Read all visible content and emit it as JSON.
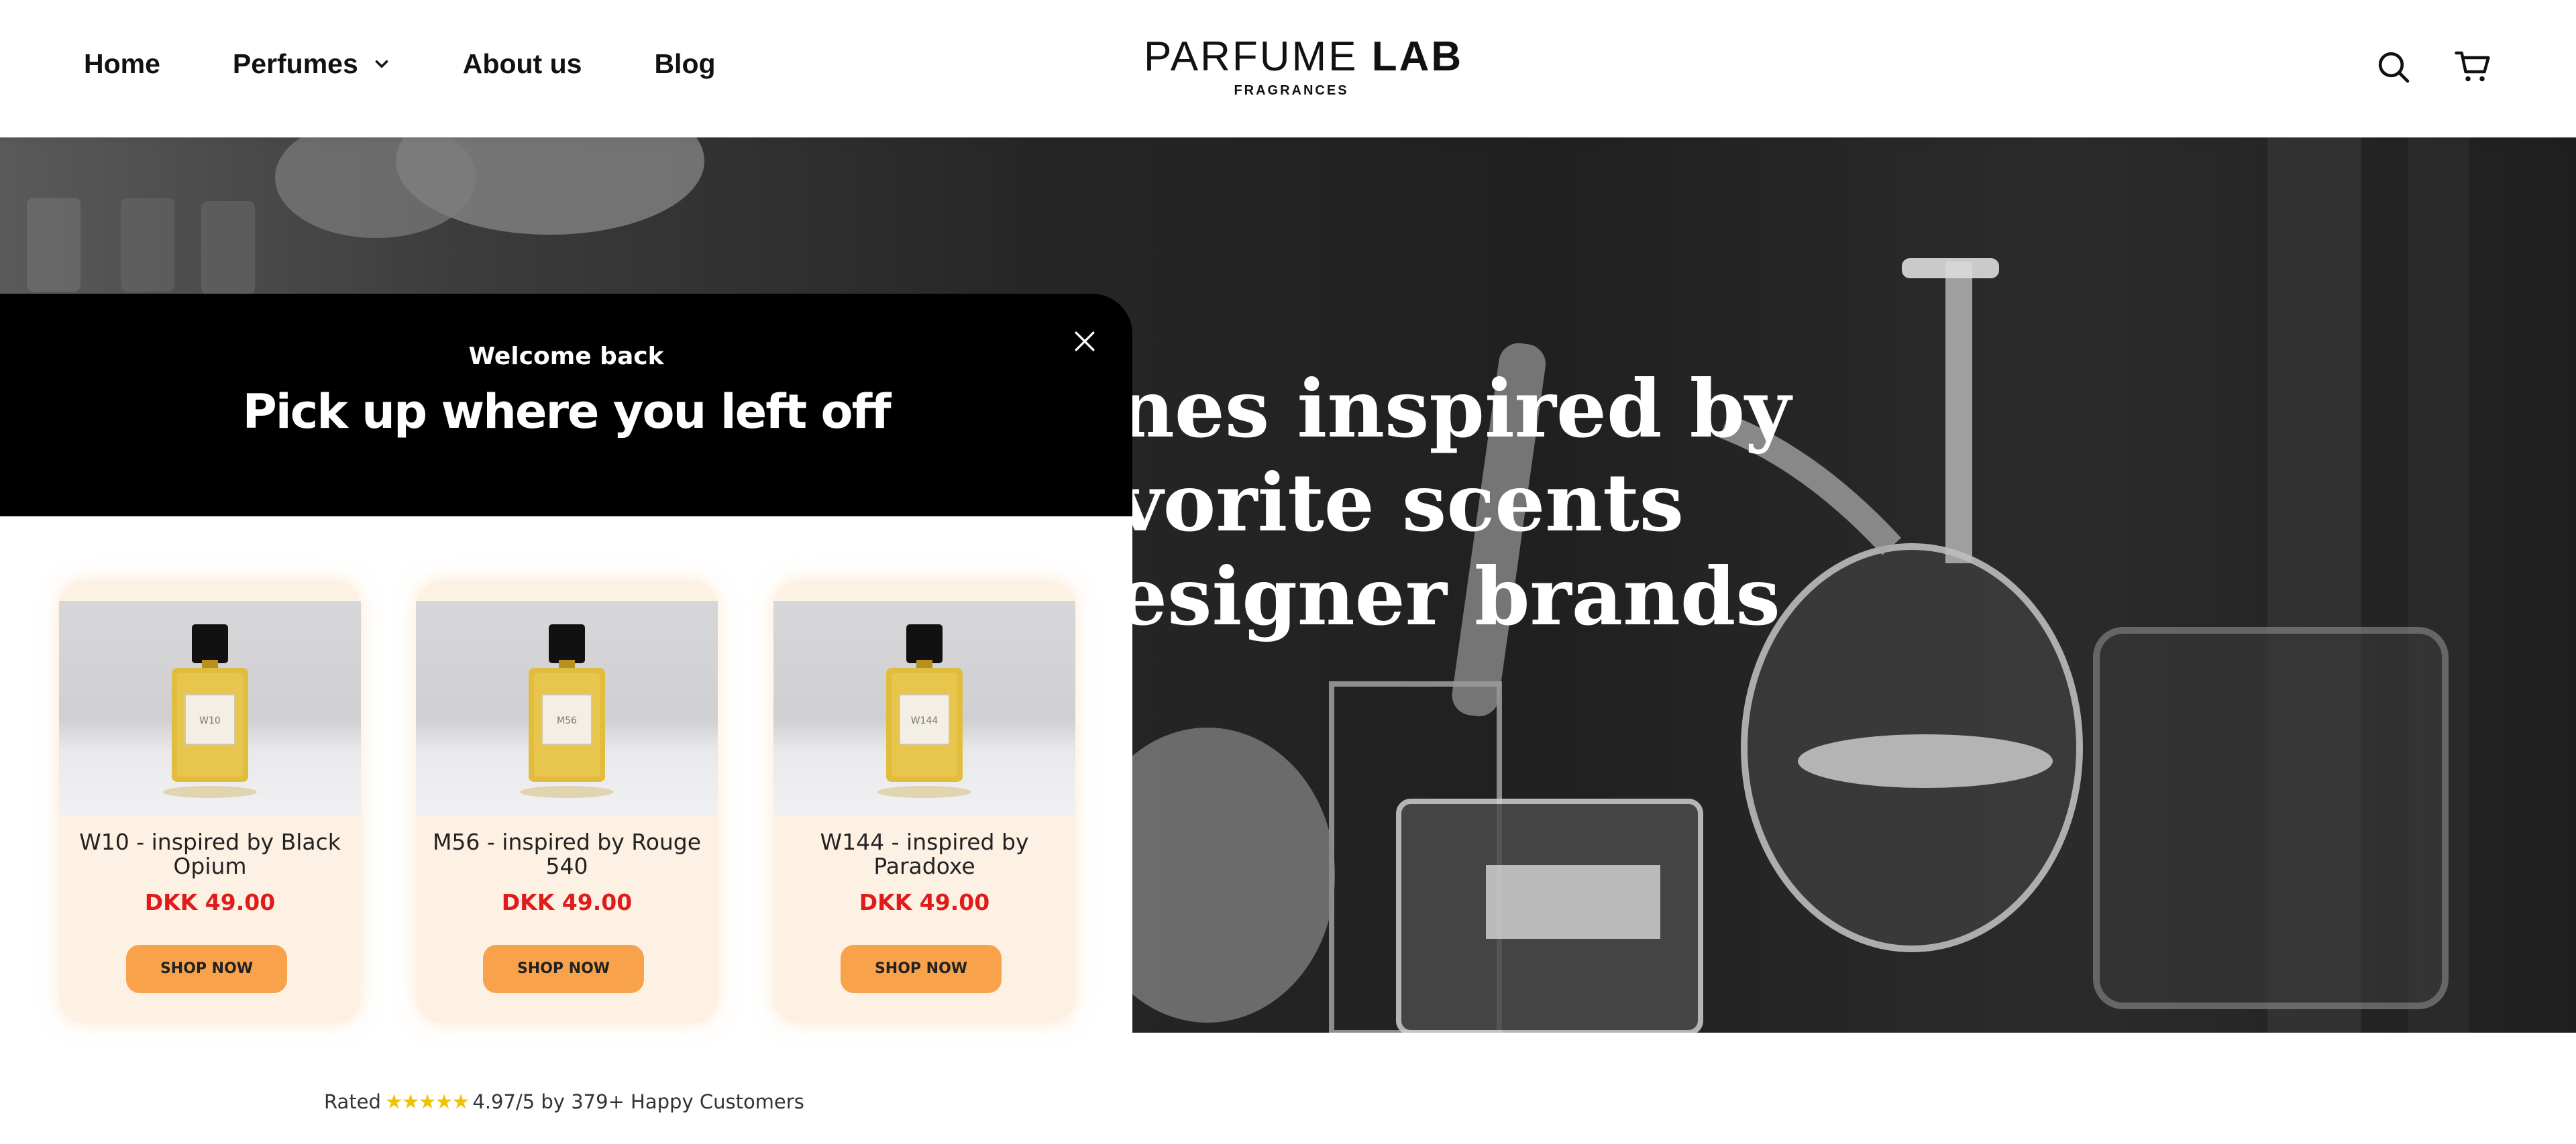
{
  "header": {
    "nav": [
      {
        "label": "Home"
      },
      {
        "label": "Perfumes",
        "has_dropdown": true
      },
      {
        "label": "About us"
      },
      {
        "label": "Blog"
      }
    ],
    "logo": {
      "main_light": "PARFUME ",
      "main_bold": "LAB",
      "sub": "FRAGRANCES"
    },
    "icons": [
      "search-icon",
      "cart-icon"
    ]
  },
  "hero": {
    "lines": [
      "nes inspired by",
      "vorite scents",
      "esigner brands"
    ]
  },
  "popup": {
    "subtitle": "Welcome back",
    "title": "Pick up where you left off",
    "close_icon": "close-icon",
    "products": [
      {
        "name": "W10 - inspired by Black Opium",
        "price": "DKK 49.00",
        "button": "SHOP NOW",
        "bottle_label": "W10"
      },
      {
        "name": "M56 - inspired by Rouge 540",
        "price": "DKK 49.00",
        "button": "SHOP NOW",
        "bottle_label": "M56"
      },
      {
        "name": "W144 - inspired by Paradoxe",
        "price": "DKK 49.00",
        "button": "SHOP NOW",
        "bottle_label": "W144"
      }
    ]
  },
  "rating": {
    "prefix": "Rated",
    "stars": "★★★★★",
    "text": "4.97/5 by 379+ Happy Customers"
  },
  "colors": {
    "accent_button": "#f9a24c",
    "price": "#e01b1b",
    "card_bg": "#fdf1e4",
    "popup_header": "#000000"
  }
}
